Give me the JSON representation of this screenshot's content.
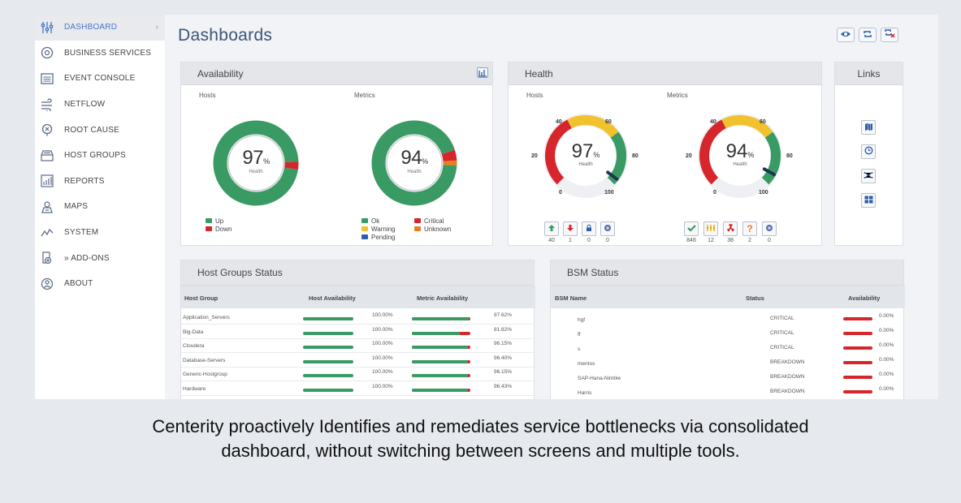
{
  "sidebar": {
    "items": [
      {
        "label": "DASHBOARD",
        "icon": "dashboard-sliders-icon",
        "active": true
      },
      {
        "label": "BUSINESS SERVICES",
        "icon": "business-services-icon"
      },
      {
        "label": "EVENT CONSOLE",
        "icon": "event-console-icon"
      },
      {
        "label": "NETFLOW",
        "icon": "netflow-icon"
      },
      {
        "label": "ROOT CAUSE",
        "icon": "root-cause-icon"
      },
      {
        "label": "HOST GROUPS",
        "icon": "host-groups-icon"
      },
      {
        "label": "REPORTS",
        "icon": "reports-icon"
      },
      {
        "label": "MAPS",
        "icon": "maps-icon"
      },
      {
        "label": "SYSTEM",
        "icon": "system-icon"
      },
      {
        "label": "» ADD-ONS",
        "icon": "add-ons-icon"
      },
      {
        "label": "ABOUT",
        "icon": "about-icon"
      }
    ]
  },
  "page_title": "Dashboards",
  "availability": {
    "title": "Availability",
    "hosts": {
      "label": "Hosts",
      "value": "97",
      "unit": "%",
      "sublabel": "Health",
      "fraction_down": 0.03
    },
    "metrics": {
      "label": "Metrics",
      "value": "94",
      "unit": "%",
      "sublabel": "Health",
      "fraction_critical": 0.04,
      "fraction_unknown": 0.02
    },
    "hosts_legend": [
      {
        "label": "Up",
        "color": "#3a9a64"
      },
      {
        "label": "Down",
        "color": "#d6262b"
      }
    ],
    "metrics_legend": [
      {
        "label": "Ok",
        "color": "#3a9a64"
      },
      {
        "label": "Critical",
        "color": "#d6262b"
      },
      {
        "label": "Warning",
        "color": "#f2c12e"
      },
      {
        "label": "Unknown",
        "color": "#e67e22"
      },
      {
        "label": "Pending",
        "color": "#2f5ea8"
      }
    ]
  },
  "health": {
    "title": "Health",
    "hosts": {
      "label": "Hosts",
      "value": "97",
      "unit": "%",
      "sublabel": "Health"
    },
    "metrics": {
      "label": "Metrics",
      "value": "94",
      "unit": "%",
      "sublabel": "Health"
    },
    "gauge_ticks": {
      "t0": "0",
      "t20": "20",
      "t40": "40",
      "t60": "60",
      "t80": "80",
      "t100": "100"
    },
    "host_status": [
      {
        "icon": "arrow-up-icon",
        "count": "40"
      },
      {
        "icon": "arrow-down-icon",
        "count": "1"
      },
      {
        "icon": "lock-icon",
        "count": "0"
      },
      {
        "icon": "pending-icon",
        "count": "0"
      }
    ],
    "metric_status": [
      {
        "icon": "check-icon",
        "count": "846"
      },
      {
        "icon": "warning-icon",
        "count": "12"
      },
      {
        "icon": "critical-icon",
        "count": "38"
      },
      {
        "icon": "unknown-icon",
        "count": "2"
      },
      {
        "icon": "pending-icon",
        "count": "0"
      }
    ]
  },
  "links": {
    "title": "Links",
    "icons": [
      "map-icon",
      "clock-icon",
      "network-icon",
      "grid-icon"
    ]
  },
  "host_groups": {
    "title": "Host Groups Status",
    "headers": {
      "group": "Host Group",
      "host": "Host Availability",
      "metric": "Metric Availability"
    },
    "rows": [
      {
        "name": "Application_Servers",
        "host_pct": "100.00%",
        "host_val": 1.0,
        "metric_pct": "97.62%",
        "metric_val": 0.9762
      },
      {
        "name": "Big-Data",
        "host_pct": "100.00%",
        "host_val": 1.0,
        "metric_pct": "81.82%",
        "metric_val": 0.8182
      },
      {
        "name": "Cloudera",
        "host_pct": "100.00%",
        "host_val": 1.0,
        "metric_pct": "96.15%",
        "metric_val": 0.9615
      },
      {
        "name": "Database-Servers",
        "host_pct": "100.00%",
        "host_val": 1.0,
        "metric_pct": "96.40%",
        "metric_val": 0.964
      },
      {
        "name": "Generic-Hostgroup",
        "host_pct": "100.00%",
        "host_val": 1.0,
        "metric_pct": "96.15%",
        "metric_val": 0.9615
      },
      {
        "name": "Hardware",
        "host_pct": "100.00%",
        "host_val": 1.0,
        "metric_pct": "96.43%",
        "metric_val": 0.9643
      }
    ]
  },
  "bsm": {
    "title": "BSM Status",
    "headers": {
      "name": "BSM Name",
      "status": "Status",
      "availability": "Availability"
    },
    "rows": [
      {
        "name": "hgf",
        "status": "CRITICAL",
        "availability": "0.00%"
      },
      {
        "name": "ff",
        "status": "CRITICAL",
        "availability": "0.00%"
      },
      {
        "name": "s",
        "status": "CRITICAL",
        "availability": "0.00%"
      },
      {
        "name": "mentos",
        "status": "BREAKDOWN",
        "availability": "0.00%"
      },
      {
        "name": "SAP-Hana-Nimble",
        "status": "BREAKDOWN",
        "availability": "0.00%"
      },
      {
        "name": "Harris",
        "status": "BREAKDOWN",
        "availability": "0.00%"
      }
    ]
  },
  "caption": {
    "line1": "Centerity proactively Identifies and remediates service bottlenecks via consolidated",
    "line2": "dashboard, without switching between screens and multiple tools."
  },
  "colors": {
    "ok": "#3a9a64",
    "critical": "#d6262b",
    "warning": "#f2c12e",
    "accent": "#4a76c8"
  }
}
